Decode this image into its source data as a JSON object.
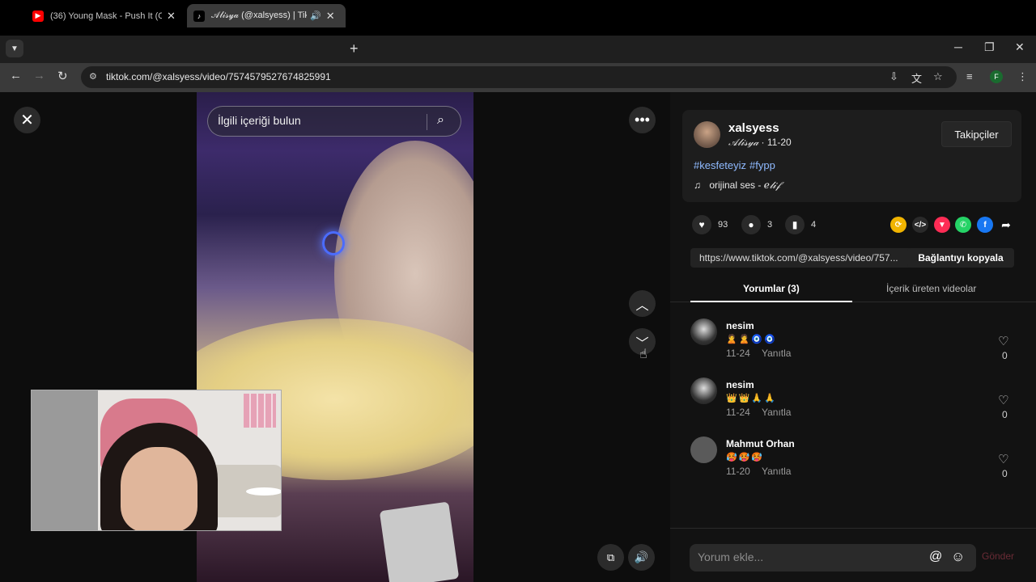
{
  "browser": {
    "tabs": [
      {
        "title": "(36) Young Mask - Push It (Offic",
        "close": "✕"
      },
      {
        "title": "𝒜𝓁𝒾𝓈𝓎𝒶 (@xalsyess) | TikTok",
        "close": "✕"
      }
    ],
    "new_tab": "+",
    "url": "tiktok.com/@xalsyess/video/7574579527674825991",
    "profile_initial": "F"
  },
  "video": {
    "search_placeholder": "İlgili içeriği bulun"
  },
  "author": {
    "username": "xalsyess",
    "display_name": "𝒜𝓁𝒾𝓈𝓎𝒶",
    "separator": "·",
    "date": "11-20",
    "follow_label": "Takipçiler",
    "hashtags": [
      "#kesfeteyiz",
      "#fypp"
    ],
    "music_prefix": "orijinal ses -",
    "music_artist": "𝑒𝓁𝒾𝒻"
  },
  "stats": {
    "likes": "93",
    "comments": "3",
    "saves": "4"
  },
  "share": {
    "link": "https://www.tiktok.com/@xalsyess/video/757...",
    "copy_label": "Bağlantıyı kopyala"
  },
  "tabs": {
    "comments": "Yorumlar (3)",
    "creator_videos": "İçerik üreten videolar"
  },
  "comments": [
    {
      "name": "nesim",
      "text": "🙎🙎🧿🧿",
      "date": "11-24",
      "reply": "Yanıtla",
      "likes": "0"
    },
    {
      "name": "nesim",
      "text": "👑👑🙏🙏",
      "date": "11-24",
      "reply": "Yanıtla",
      "likes": "0"
    },
    {
      "name": "Mahmut Orhan",
      "text": "🥵🥵🥵",
      "date": "11-20",
      "reply": "Yanıtla",
      "likes": "0"
    }
  ],
  "composer": {
    "placeholder": "Yorum ekle...",
    "send_label": "Gönder"
  },
  "colors": {
    "accent_link": "#8fbaff",
    "panel_bg": "#121212",
    "send_disabled": "#6a2b35"
  }
}
